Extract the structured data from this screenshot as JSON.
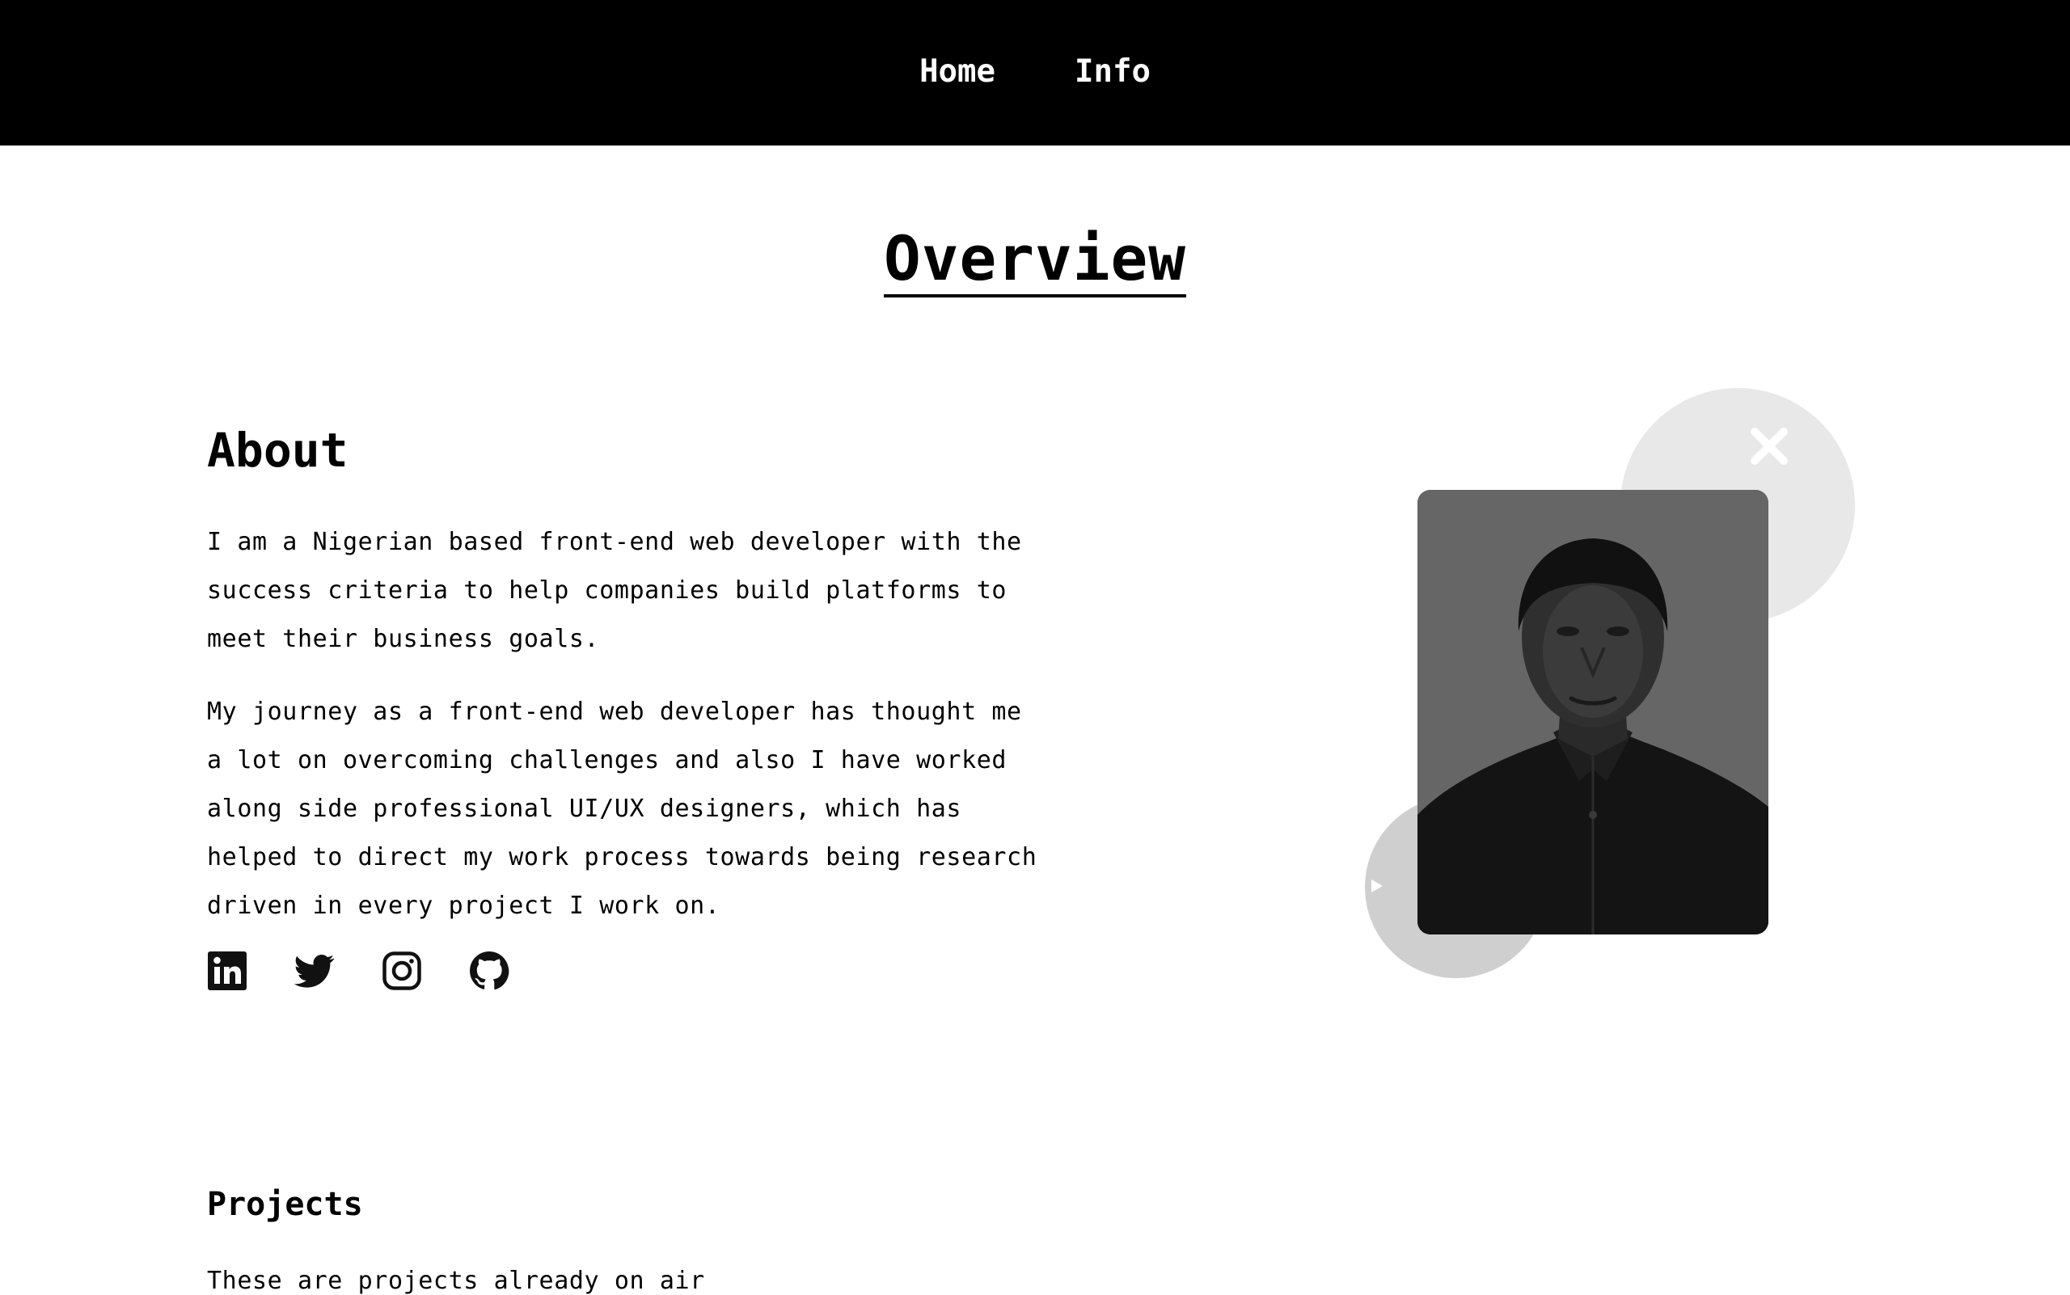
{
  "nav": {
    "items": [
      {
        "label": "Home"
      },
      {
        "label": "Info"
      }
    ]
  },
  "overview": {
    "title": "Overview"
  },
  "about": {
    "heading": "About",
    "paragraph1": "I am a Nigerian based front-end web developer with the success criteria to help companies build platforms to meet their business goals.",
    "paragraph2": "My journey as a front-end web developer has thought me a lot on overcoming challenges and also I have worked along side professional UI/UX designers, which has helped to direct my work process towards being research driven in every project I work on.",
    "socials": [
      {
        "icon": "linkedin-icon"
      },
      {
        "icon": "twitter-icon"
      },
      {
        "icon": "instagram-icon"
      },
      {
        "icon": "github-icon"
      }
    ]
  },
  "projects": {
    "heading": "Projects",
    "description": "These are projects already on air"
  },
  "colors": {
    "nav_background": "#000000",
    "nav_text": "#ffffff",
    "page_background": "#ffffff",
    "text": "#000000",
    "deco_circle_light": "#e8e8e8",
    "deco_circle_dark": "#cfcfcf",
    "portrait_background": "#666666"
  }
}
